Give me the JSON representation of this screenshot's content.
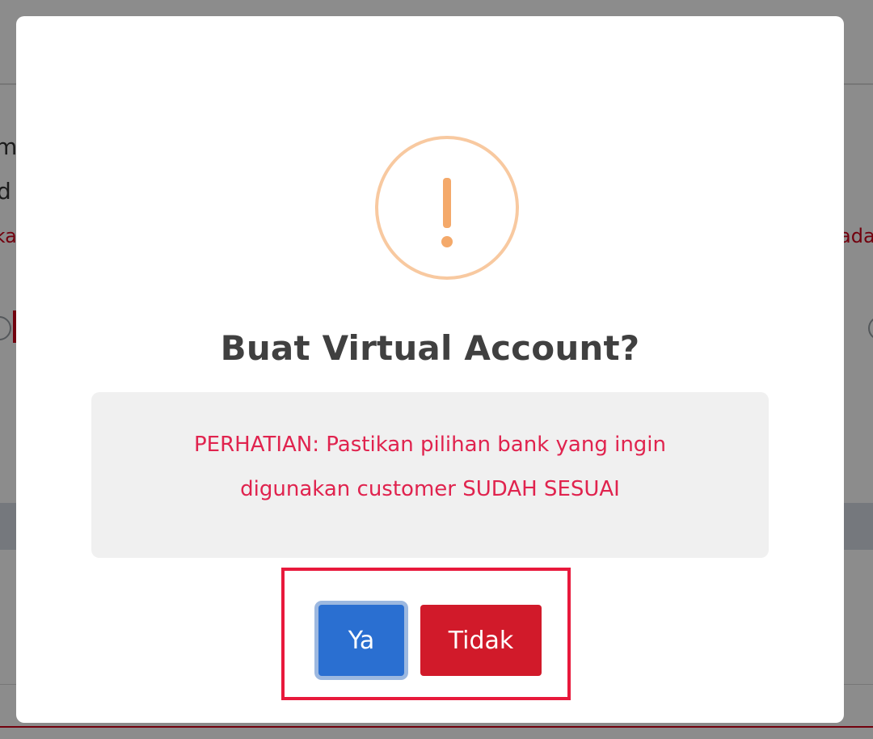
{
  "background": {
    "left_fragments": [
      "m",
      "d",
      "ika"
    ],
    "right_fragments": [
      "ada"
    ]
  },
  "dialog": {
    "icon": "warning-exclamation-icon",
    "icon_glyph": "!",
    "title": "Buat Virtual Account?",
    "message": "PERHATIAN: Pastikan pilihan bank yang ingin digunakan customer SUDAH SESUAI",
    "buttons": {
      "confirm_label": "Ya",
      "cancel_label": "Tidak"
    }
  },
  "colors": {
    "overlay": "#8c8c8c",
    "warning_icon": "#f8c9a0",
    "message_text": "#e0234e",
    "confirm_button": "#2a6fd1",
    "cancel_button": "#d11a2a",
    "highlight_border": "#e8193c"
  }
}
